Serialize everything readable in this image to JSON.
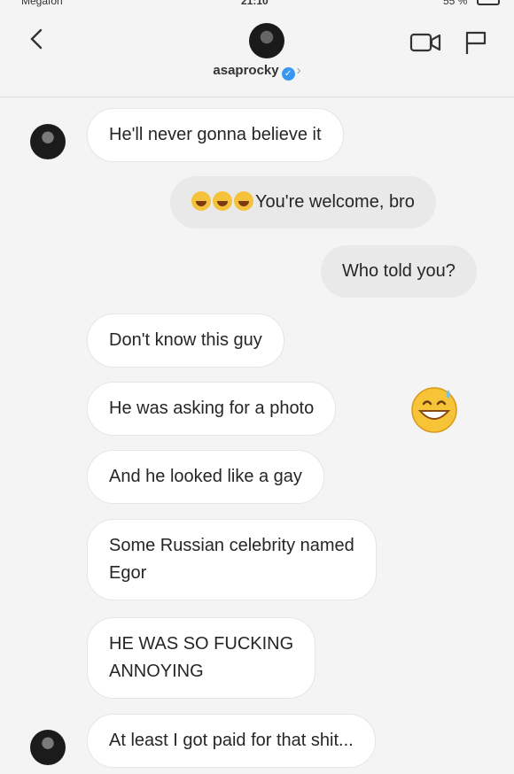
{
  "status_bar": {
    "carrier": "Megafon",
    "time": "21:10",
    "battery": "55 %"
  },
  "header": {
    "username": "asaprocky",
    "verified_mark": "✓",
    "chevron": "›"
  },
  "messages": [
    {
      "text": "He'll never gonna believe it"
    },
    {
      "text": "You're welcome, bro",
      "emoji": "face-with-tears-of-joy"
    },
    {
      "text": "Who told you?"
    },
    {
      "text": "Don't know this guy"
    },
    {
      "text": "He was asking for a photo"
    },
    {
      "text": "And he looked like a gay"
    },
    {
      "text": "Some Russian celebrity named",
      "text2": "Egor"
    },
    {
      "text": "HE WAS SO FUCKING",
      "text2": "ANNOYING"
    },
    {
      "text": "At least I got paid for that shit..."
    }
  ],
  "reaction_emoji": "grinning-face-with-sweat",
  "icons": {
    "back": "chevron-left-icon",
    "video": "video-call-icon",
    "flag": "flag-icon"
  }
}
